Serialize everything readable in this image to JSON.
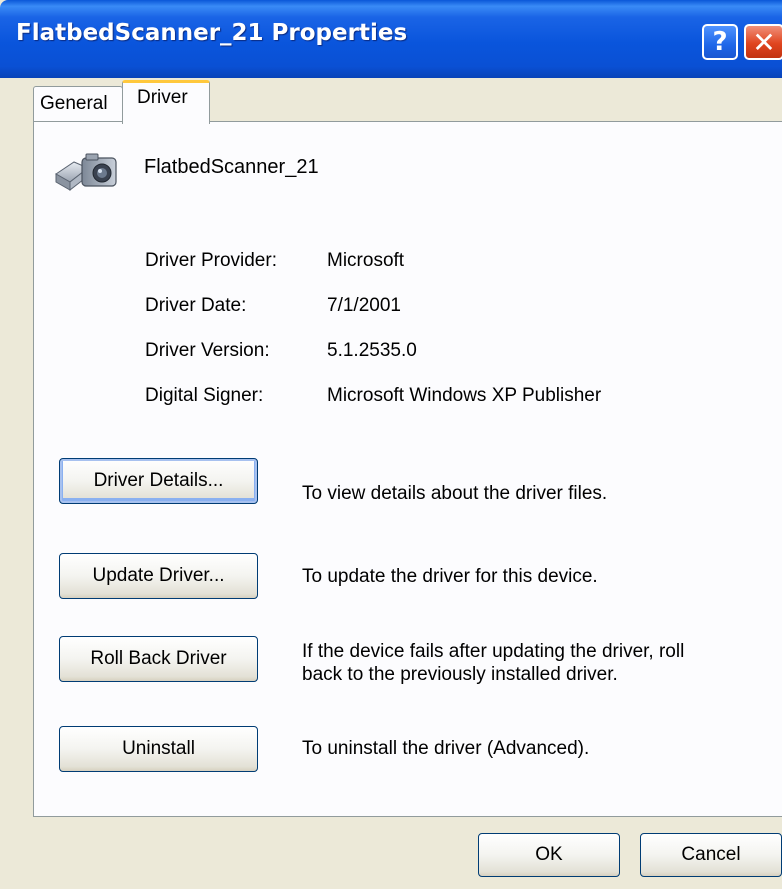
{
  "window": {
    "title": "FlatbedScanner_21 Properties",
    "help_label": "?",
    "close_label": "✕"
  },
  "tabs": [
    {
      "label": "General",
      "active": false
    },
    {
      "label": "Driver",
      "active": true
    }
  ],
  "device": {
    "icon": "scanner-icon",
    "name": "FlatbedScanner_21"
  },
  "driver_info": {
    "provider_label": "Driver Provider:",
    "provider_value": "Microsoft",
    "date_label": "Driver Date:",
    "date_value": "7/1/2001",
    "version_label": "Driver Version:",
    "version_value": "5.1.2535.0",
    "signer_label": "Digital Signer:",
    "signer_value": "Microsoft Windows XP Publisher"
  },
  "actions": [
    {
      "label": "Driver Details...",
      "description": "To view details about the driver files."
    },
    {
      "label": "Update Driver...",
      "description": "To update the driver for this device."
    },
    {
      "label": "Roll Back Driver",
      "description": "If the device fails after updating the driver, roll back to the previously installed driver."
    },
    {
      "label": "Uninstall",
      "description": "To uninstall the driver (Advanced)."
    }
  ],
  "footer": {
    "ok_label": "OK",
    "cancel_label": "Cancel"
  },
  "colors": {
    "titlebar": "#0a55dc",
    "close_button": "#e0451f",
    "dialog_bg": "#ece9d8",
    "panel_bg": "#fcfcfe",
    "active_tab_accent": "#ffc83c"
  }
}
